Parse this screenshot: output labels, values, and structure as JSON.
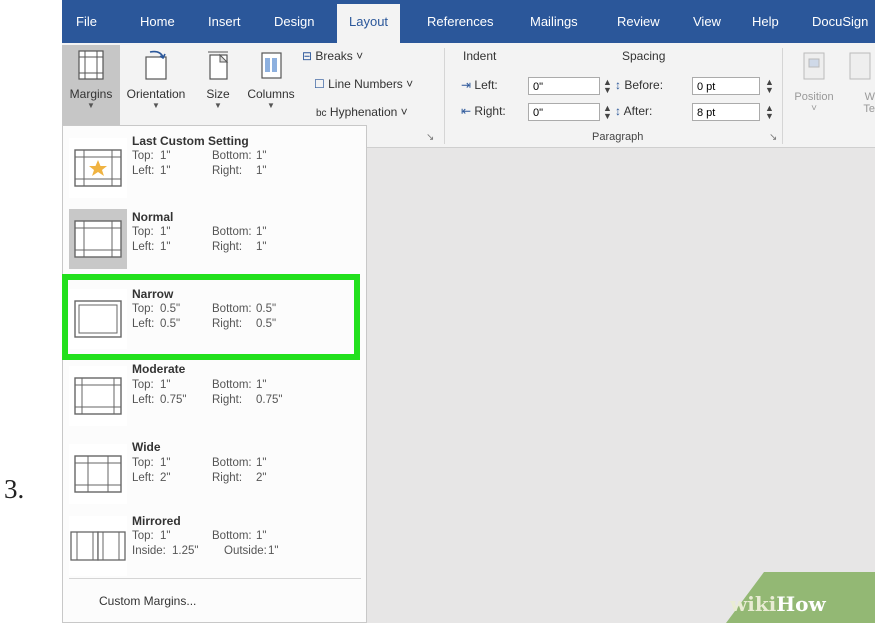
{
  "step_number": "3.",
  "tabs": [
    "File",
    "Home",
    "Insert",
    "Design",
    "Layout",
    "References",
    "Mailings",
    "Review",
    "View",
    "Help",
    "DocuSign"
  ],
  "active_tab": "Layout",
  "ribbon": {
    "margins": "Margins",
    "orientation": "Orientation",
    "size": "Size",
    "columns": "Columns",
    "breaks": "Breaks ˅",
    "line_numbers": "Line Numbers ˅",
    "hyphenation": "Hyphenation ˅",
    "indent": {
      "header": "Indent",
      "left_label": "Left:",
      "left_value": "0\"",
      "right_label": "Right:",
      "right_value": "0\""
    },
    "spacing": {
      "header": "Spacing",
      "before_label": "Before:",
      "before_value": "0 pt",
      "after_label": "After:",
      "after_value": "8 pt"
    },
    "paragraph_group": "Paragraph",
    "position": "Position",
    "position_caret": "˅",
    "wrap_text_partial": "W",
    "wrap_text_partial2": "Te"
  },
  "margins_menu": [
    {
      "name": "Last Custom Setting",
      "top_label": "Top:",
      "top": "1\"",
      "bottom_label": "Bottom:",
      "bottom": "1\"",
      "left_label": "Left:",
      "left": "1\"",
      "right_label": "Right:",
      "right": "1\""
    },
    {
      "name": "Normal",
      "top_label": "Top:",
      "top": "1\"",
      "bottom_label": "Bottom:",
      "bottom": "1\"",
      "left_label": "Left:",
      "left": "1\"",
      "right_label": "Right:",
      "right": "1\""
    },
    {
      "name": "Narrow",
      "top_label": "Top:",
      "top": "0.5\"",
      "bottom_label": "Bottom:",
      "bottom": "0.5\"",
      "left_label": "Left:",
      "left": "0.5\"",
      "right_label": "Right:",
      "right": "0.5\""
    },
    {
      "name": "Moderate",
      "top_label": "Top:",
      "top": "1\"",
      "bottom_label": "Bottom:",
      "bottom": "1\"",
      "left_label": "Left:",
      "left": "0.75\"",
      "right_label": "Right:",
      "right": "0.75\""
    },
    {
      "name": "Wide",
      "top_label": "Top:",
      "top": "1\"",
      "bottom_label": "Bottom:",
      "bottom": "1\"",
      "left_label": "Left:",
      "left": "2\"",
      "right_label": "Right:",
      "right": "2\""
    },
    {
      "name": "Mirrored",
      "top_label": "Top:",
      "top": "1\"",
      "bottom_label": "Bottom:",
      "bottom": "1\"",
      "left_label": "Inside:",
      "left": "1.25\"",
      "right_label": "Outside:",
      "right": "1\""
    }
  ],
  "custom_margins": "Custom Margins...",
  "watermark": {
    "wiki": "wiki",
    "how": "How"
  },
  "colors": {
    "ribbon_tab_bar": "#2b579a",
    "highlight": "#22e01d",
    "selected_item": "#c8c8c8"
  }
}
